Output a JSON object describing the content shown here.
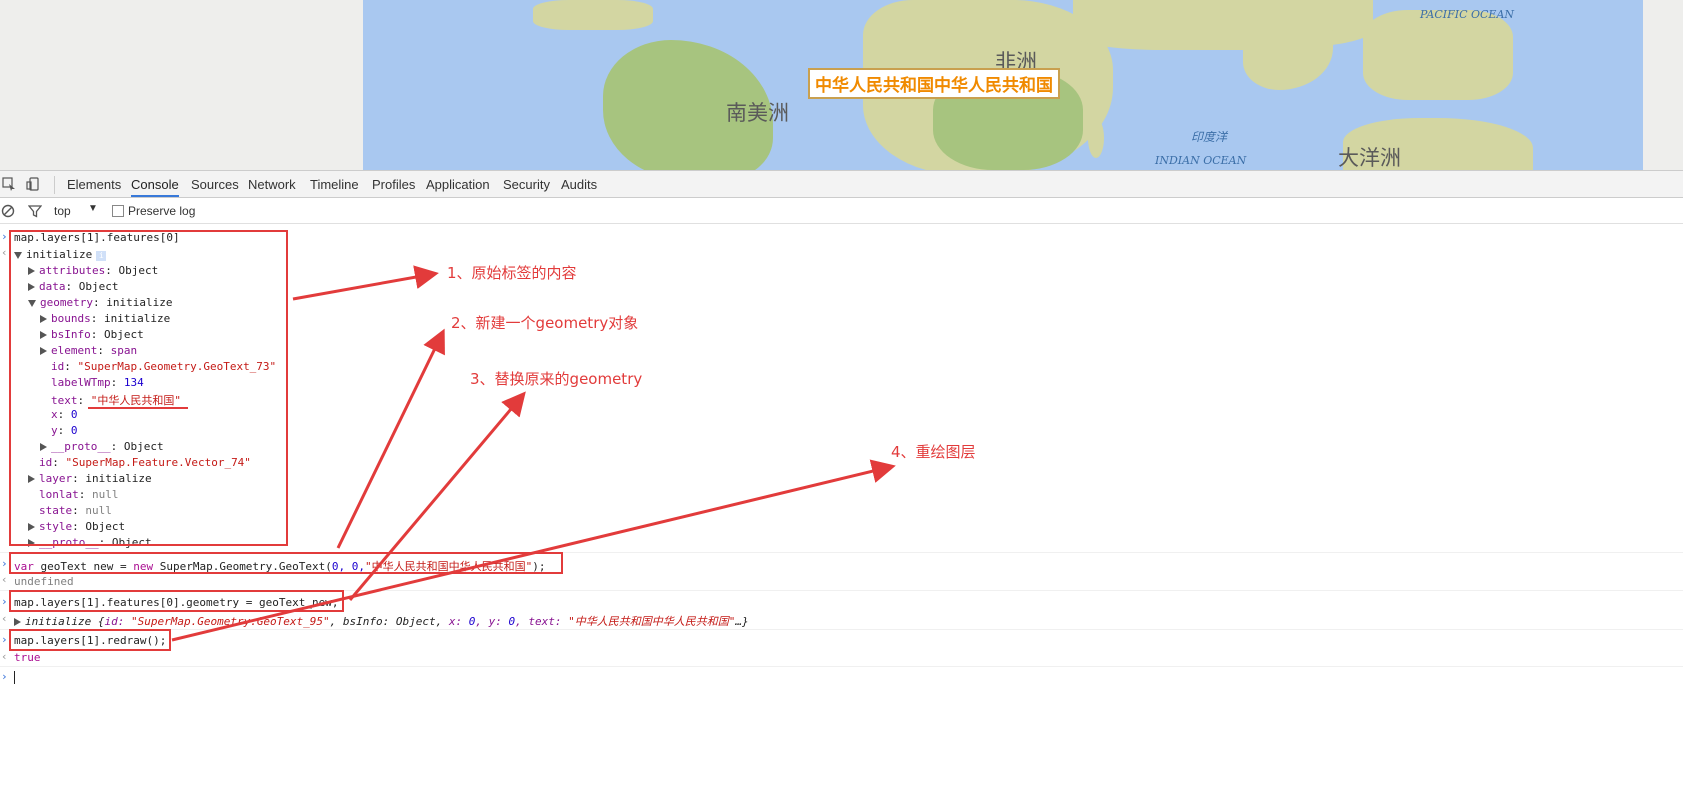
{
  "map": {
    "continent_labels": [
      "南美洲",
      "非洲",
      "大洋洲"
    ],
    "ocean_labels": [
      "PACIFIC OCEAN",
      "印度洋",
      "INDIAN OCEAN"
    ],
    "geotext_label": "中华人民共和国中华人民共和国"
  },
  "devtools": {
    "tabs": [
      "Elements",
      "Console",
      "Sources",
      "Network",
      "Timeline",
      "Profiles",
      "Application",
      "Security",
      "Audits"
    ],
    "active_tab": "Console",
    "context": "top",
    "preserve_log": "Preserve log"
  },
  "console": {
    "cmd1": "map.layers[1].features[0]",
    "obj_name": "initialize",
    "info_badge": "i",
    "props": {
      "attributes": "Object",
      "data": "Object",
      "geometry": "initialize",
      "bounds": "initialize",
      "bsInfo": "Object",
      "element": "span",
      "id": "\"SuperMap.Geometry.GeoText_73\"",
      "labelWTmp": "134",
      "text": "\"中华人民共和国\"",
      "x": "0",
      "y": "0",
      "proto_inner": "Object",
      "feature_id": "\"SuperMap.Feature.Vector_74\"",
      "layer": "initialize",
      "lonlat": "null",
      "state": "null",
      "style": "Object",
      "proto_outer": "Object"
    },
    "prop_names": {
      "attributes": "attributes",
      "data": "data",
      "geometry": "geometry",
      "bounds": "bounds",
      "bsInfo": "bsInfo",
      "element": "element",
      "id": "id",
      "labelWTmp": "labelWTmp",
      "text": "text",
      "x": "x",
      "y": "y",
      "proto": "__proto__",
      "layer": "layer",
      "lonlat": "lonlat",
      "state": "state",
      "style": "style"
    },
    "cmd2_var": "var",
    "cmd2_name": "geoText_new = ",
    "cmd2_new": "new",
    "cmd2_ctor": "SuperMap.Geometry.GeoText(",
    "cmd2_args_num": "0, 0,",
    "cmd2_args_str": "\"中华人民共和国中华人民共和国\"",
    "cmd2_end": ");",
    "ret2": "undefined",
    "cmd3": "map.layers[1].features[0].geometry = geoText_new;",
    "ret3_name": "initialize",
    "ret3_open": "{",
    "ret3_id_key": "id: ",
    "ret3_id_val": "\"SuperMap.Geometry.GeoText_95\"",
    "ret3_bs": ", bsInfo: Object, ",
    "ret3_x": "x: ",
    "ret3_x_val": "0",
    "ret3_y": ", y: ",
    "ret3_y_val": "0",
    "ret3_text": ", text: ",
    "ret3_text_val": "\"中华人民共和国中华人民共和国\"",
    "ret3_close": "…}",
    "cmd4": "map.layers[1].redraw();",
    "ret4": "true"
  },
  "annotations": {
    "note1": "1、原始标签的内容",
    "note2": "2、新建一个geometry对象",
    "note3": "3、替换原来的geometry",
    "note4": "4、重绘图层"
  },
  "colors": {
    "annotation_red": "#e23b3b",
    "geotext_orange": "#f08a00",
    "ocean_blue": "#a9c8f0"
  }
}
